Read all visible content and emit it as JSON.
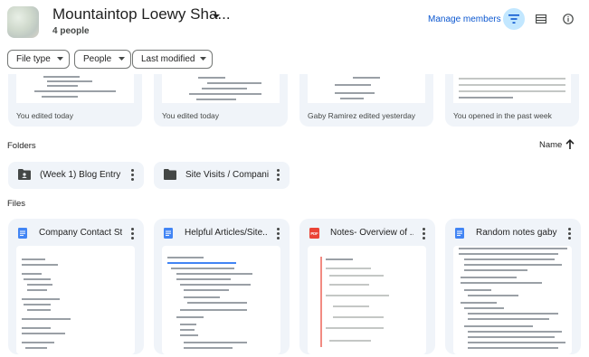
{
  "header": {
    "title": "Mountaintop Loewy Sha...",
    "subtitle": "4 people",
    "manage_label": "Manage members"
  },
  "filters": {
    "chips": [
      {
        "label": "File type"
      },
      {
        "label": "People"
      },
      {
        "label": "Last modified"
      }
    ]
  },
  "suggested": [
    {
      "caption": "You edited today"
    },
    {
      "caption": "You edited today"
    },
    {
      "caption": "Gaby Ramirez edited yesterday"
    },
    {
      "caption": "You opened in the past week"
    }
  ],
  "folders": {
    "section_label": "Folders",
    "sort_label": "Name",
    "items": [
      {
        "name": "(Week 1) Blog Entry ...",
        "icon": "shared-folder-icon"
      },
      {
        "name": "Site Visits / Compani...",
        "icon": "folder-icon"
      }
    ]
  },
  "files": {
    "section_label": "Files",
    "items": [
      {
        "name": "Company Contact St...",
        "icon": "google-docs-icon",
        "icon_color": "#4285f4"
      },
      {
        "name": "Helpful Articles/Site...",
        "icon": "google-docs-icon",
        "icon_color": "#4285f4"
      },
      {
        "name": "Notes- Overview of ...",
        "icon": "pdf-icon",
        "icon_color": "#ea4335"
      },
      {
        "name": "Random notes gaby",
        "icon": "google-docs-icon",
        "icon_color": "#4285f4"
      }
    ]
  },
  "colors": {
    "accent": "#0b57d0",
    "card_bg": "#f0f4f9",
    "active_button": "#c2e7ff"
  }
}
